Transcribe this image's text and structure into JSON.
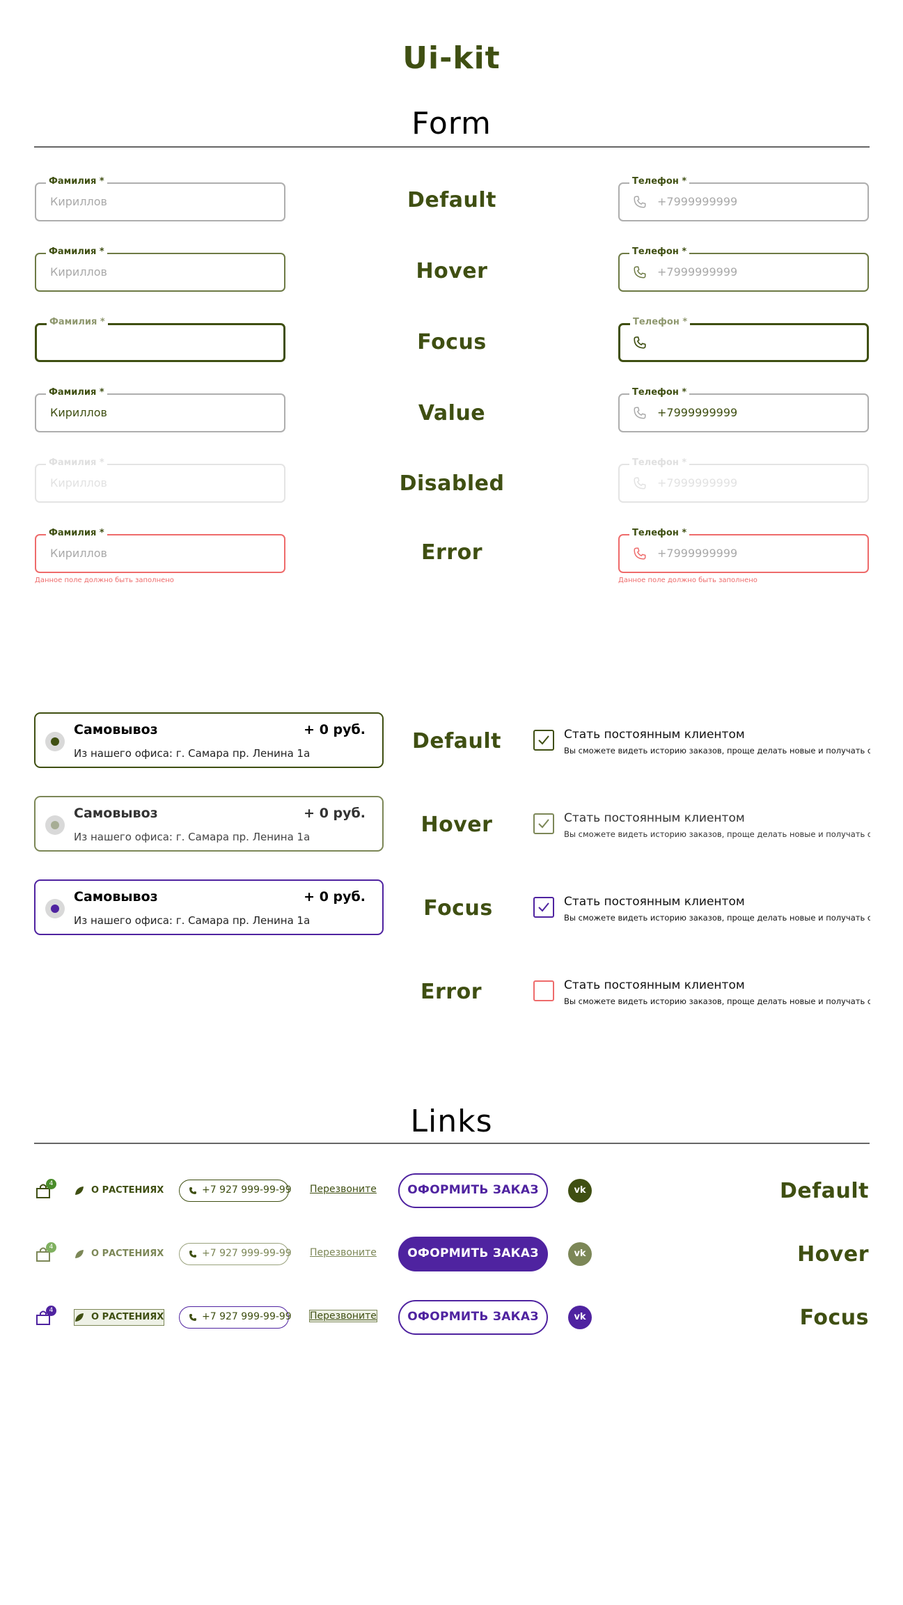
{
  "title": "Ui-kit",
  "form": {
    "heading": "Form",
    "surname_label": "Фамилия *",
    "surname_placeholder": "Кириллов",
    "phone_label": "Телефон *",
    "phone_placeholder": "+7999999999",
    "error_text": "Данное поле должно быть заполнено",
    "states": [
      "Default",
      "Hover",
      "Focus",
      "Value",
      "Disabled",
      "Error"
    ]
  },
  "selection": {
    "radio": {
      "title": "Самовывоз",
      "price": "+ 0 руб.",
      "description": "Из нашего офиса: г. Самара пр. Ленина 1а"
    },
    "checkbox": {
      "title": "Стать постоянным клиентом",
      "description": "Вы сможете видеть историю заказов, проще делать новые и получать скидки"
    },
    "states": [
      "Default",
      "Hover",
      "Focus",
      "Error"
    ]
  },
  "links": {
    "heading": "Links",
    "cart_count": "4",
    "about_plants": "О РАСТЕНИЯХ",
    "phone": "+7 927 999-99-99",
    "callback": "Перезвоните",
    "order_button": "ОФОРМИТЬ ЗАКАЗ",
    "vk_icon": "vk-icon",
    "states": [
      "Default",
      "Hover",
      "Focus"
    ]
  },
  "colors": {
    "primary_green": "#3f4f12",
    "hover_green": "#7c8757",
    "focus_purple": "#4f23a0",
    "error_red": "#ee6b6b",
    "badge_green": "#4a8c2a"
  }
}
